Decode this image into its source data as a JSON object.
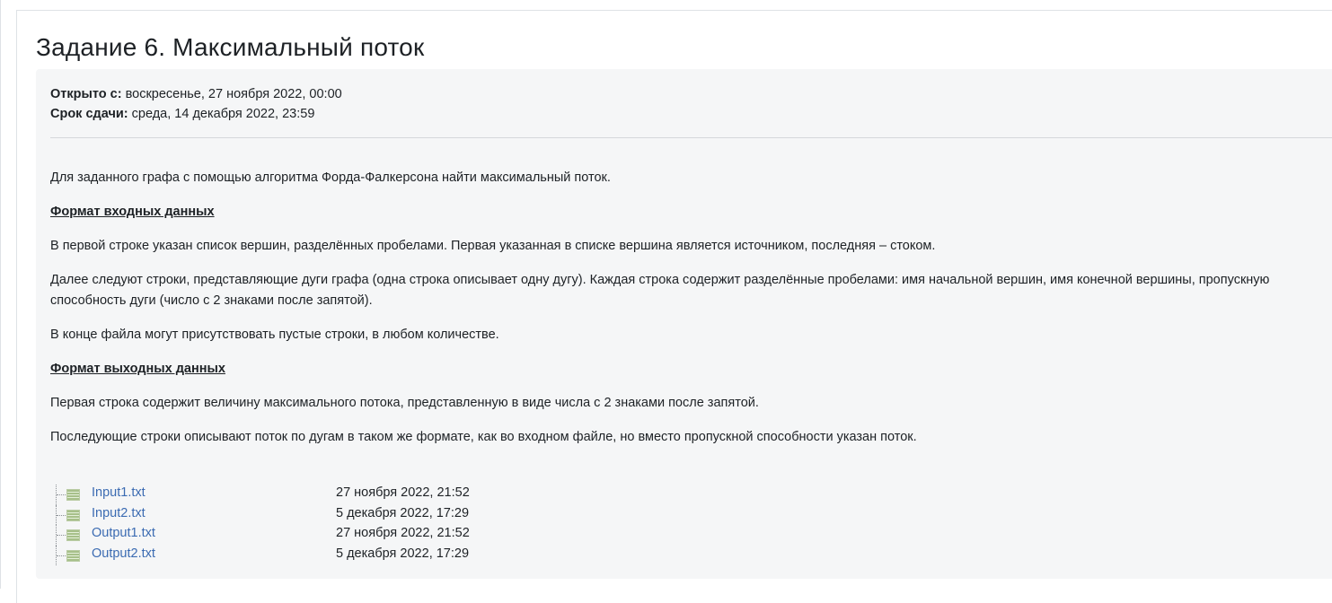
{
  "page_title": "Задание 6. Максимальный поток",
  "dates": {
    "opened_label": "Открыто с:",
    "opened_value": "воскресенье, 27 ноября 2022, 00:00",
    "due_label": "Срок сдачи:",
    "due_value": "среда, 14 декабря 2022, 23:59"
  },
  "description": {
    "intro": "Для заданного графа с помощью алгоритма Форда-Фалкерсона найти максимальный поток.",
    "input_heading": "Формат входных данных",
    "input_p1": "В первой строке указан список вершин, разделённых пробелами. Первая указанная в списке вершина является источником, последняя – стоком.",
    "input_p2": "Далее следуют строки, представляющие дуги графа (одна строка описывает одну дугу). Каждая строка содержит разделённые пробелами: имя начальной вершин, имя конечной вершины, пропускную способность дуги (число с 2 знаками после запятой).",
    "input_p3": "В конце файла могут присутствовать пустые строки, в любом количестве.",
    "output_heading": "Формат выходных данных",
    "output_p1": "Первая строка содержит величину максимального потока, представленную в виде числа с 2 знаками после запятой.",
    "output_p2": "Последующие строки описывают поток по дугам в таком же формате, как во входном файле, но вместо пропускной способности указан поток."
  },
  "files": [
    {
      "name": "Input1.txt",
      "date": "27 ноября 2022, 21:52",
      "icon": "text-file-icon"
    },
    {
      "name": "Input2.txt",
      "date": "5 декабря 2022, 17:29",
      "icon": "text-file-icon"
    },
    {
      "name": "Output1.txt",
      "date": "27 ноября 2022, 21:52",
      "icon": "text-file-icon"
    },
    {
      "name": "Output2.txt",
      "date": "5 декабря 2022, 17:29",
      "icon": "text-file-icon"
    }
  ],
  "colors": {
    "link": "#3b6bb2",
    "panel_bg": "#f5f6f7",
    "text": "#1d2125"
  }
}
